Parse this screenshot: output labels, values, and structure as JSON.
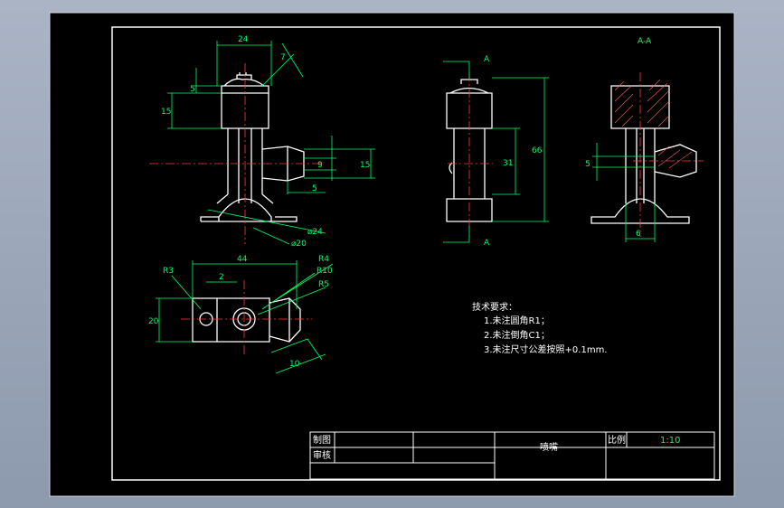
{
  "drawing": {
    "section_label": "A-A",
    "cut_mark_top": "A",
    "cut_mark_bottom": "A"
  },
  "dims": {
    "front": {
      "width_24": "24",
      "h5": "5",
      "h15": "15",
      "angle_tag": "7",
      "h9": "9",
      "h15b": "15",
      "w5": "5",
      "d24": "⌀24",
      "d20": "⌀20"
    },
    "side": {
      "h31": "31",
      "h66": "66"
    },
    "section": {
      "h5": "5",
      "w6": "6"
    },
    "top": {
      "w44": "44",
      "w2": "2",
      "h20": "20",
      "r3": "R3",
      "r4": "R4",
      "r10": "R10",
      "r5": "R5",
      "w10": "10"
    }
  },
  "notes": {
    "title": "技术要求：",
    "items": [
      "1.未注圆角R1；",
      "2.未注倒角C1；",
      "3.未注尺寸公差按照+0.1mm."
    ]
  },
  "title_block": {
    "drawn_label": "制图",
    "checked_label": "审核",
    "part_name": "喷嘴",
    "scale_label": "比例",
    "scale_value": "1:10"
  },
  "colors": {
    "line": "#ffffff",
    "dim": "#00ff66",
    "center": "#ff3b3b",
    "paper": "#000000"
  }
}
